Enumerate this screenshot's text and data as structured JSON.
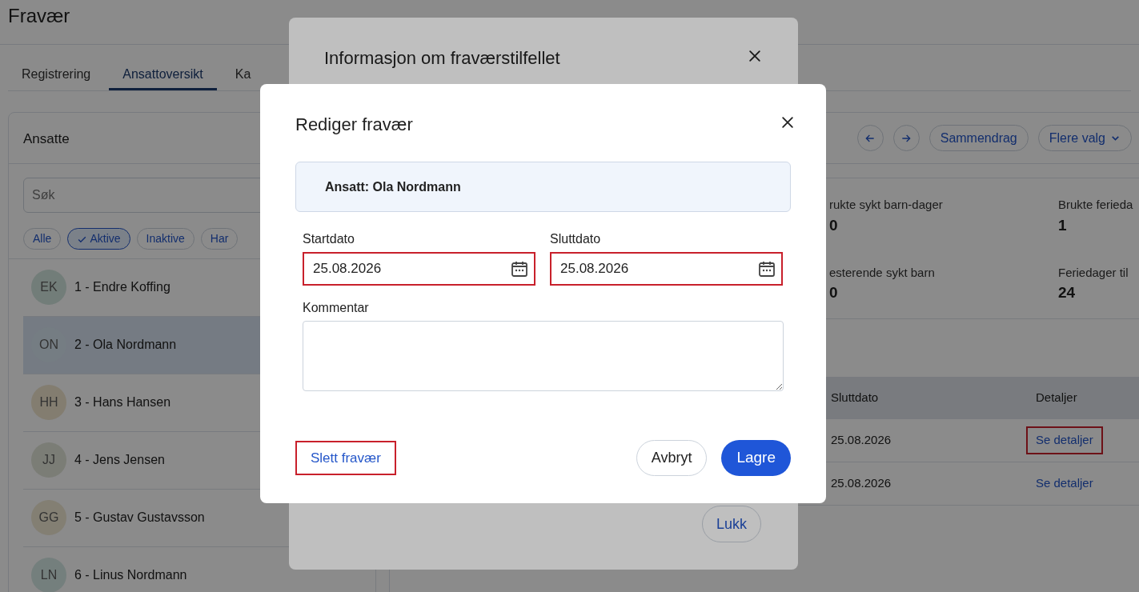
{
  "page": {
    "title": "Fravær"
  },
  "tabs": [
    {
      "label": "Registrering",
      "selected": false
    },
    {
      "label": "Ansattoversikt",
      "selected": true
    },
    {
      "label": "Ka",
      "selected": false
    }
  ],
  "employees_panel": {
    "title": "Ansatte",
    "search": {
      "placeholder": "Søk"
    },
    "filters": [
      {
        "label": "Alle",
        "selected": false
      },
      {
        "label": "Aktive",
        "selected": true
      },
      {
        "label": "Inaktive",
        "selected": false
      },
      {
        "label": "Har",
        "selected": false
      }
    ],
    "employees": [
      {
        "initials": "EK",
        "name": "1 - Endre Koffing",
        "color": "#727d79",
        "selected": false
      },
      {
        "initials": "ON",
        "name": "2 - Ola Nordmann",
        "color": "#757d83",
        "selected": true
      },
      {
        "initials": "HH",
        "name": "3 - Hans Hansen",
        "color": "#837d70",
        "selected": false
      },
      {
        "initials": "JJ",
        "name": "4 - Jens Jensen",
        "color": "#7b7d76",
        "selected": false
      },
      {
        "initials": "GG",
        "name": "5 - Gustav Gustavsson",
        "color": "#837f73",
        "selected": false
      },
      {
        "initials": "LN",
        "name": "6 - Linus Nordmann",
        "color": "#747f7d",
        "selected": false
      }
    ]
  },
  "toolbar_buttons": [
    {
      "label": "Sammendrag",
      "dropdown": false
    },
    {
      "label": "Flere valg",
      "dropdown": true
    }
  ],
  "stats": [
    {
      "label": "rukte sykt barn-dager",
      "value": "0"
    },
    {
      "label": "Brukte ferieda",
      "value": "1"
    },
    {
      "label": "esterende sykt barn",
      "value": "0"
    },
    {
      "label": "Feriedager til",
      "value": "24"
    }
  ],
  "absences_table": {
    "columns": [
      "Sluttdato",
      "Detaljer"
    ],
    "rows": [
      {
        "end_date": "25.08.2026",
        "details_link": "Se detaljer",
        "highlighted": true
      },
      {
        "end_date": "25.08.2026",
        "details_link": "Se detaljer",
        "highlighted": false
      }
    ]
  },
  "info_dialog": {
    "title": "Informasjon om fraværstilfellet",
    "close_button": "Lukk"
  },
  "edit_dialog": {
    "title": "Rediger fravær",
    "employee_info": "Ansatt: Ola Nordmann",
    "start_date": {
      "label": "Startdato",
      "value": "25.08.2026",
      "highlighted": true
    },
    "end_date": {
      "label": "Sluttdato",
      "value": "25.08.2026",
      "highlighted": true
    },
    "comment": {
      "label": "Kommentar"
    },
    "delete_button": {
      "label": "Slett fravær",
      "highlighted": true
    },
    "cancel_button": "Avbryt",
    "save_button": "Lagre"
  }
}
